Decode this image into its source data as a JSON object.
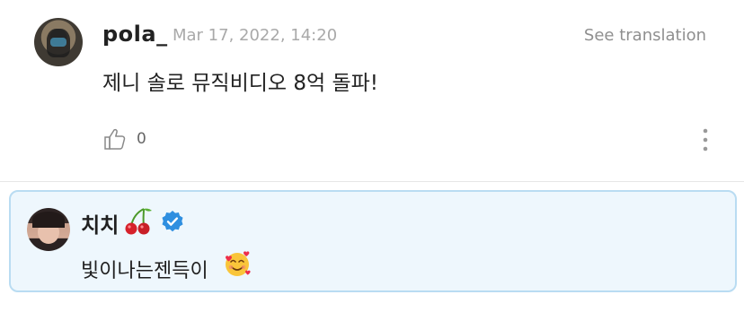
{
  "comment": {
    "username": "pola_",
    "timestamp": "Mar 17, 2022, 14:20",
    "see_translation": "See translation",
    "text": "제니 솔로 뮤직비디오 8억 돌파!",
    "like_count": "0",
    "icons": {
      "like": "thumbs-up-icon",
      "more": "more-vertical-icon"
    }
  },
  "reply": {
    "username": "치치",
    "text": "빛이나는젠득이",
    "icons": {
      "name_emoji": "cherry-icon",
      "badge": "verified-icon",
      "text_emoji": "smiling-face-with-hearts-icon"
    }
  },
  "colors": {
    "reply_bg": "#eef7fd",
    "reply_border": "#b9dcf2",
    "verified": "#2f8fe0",
    "timestamp": "#a9a9a9"
  }
}
